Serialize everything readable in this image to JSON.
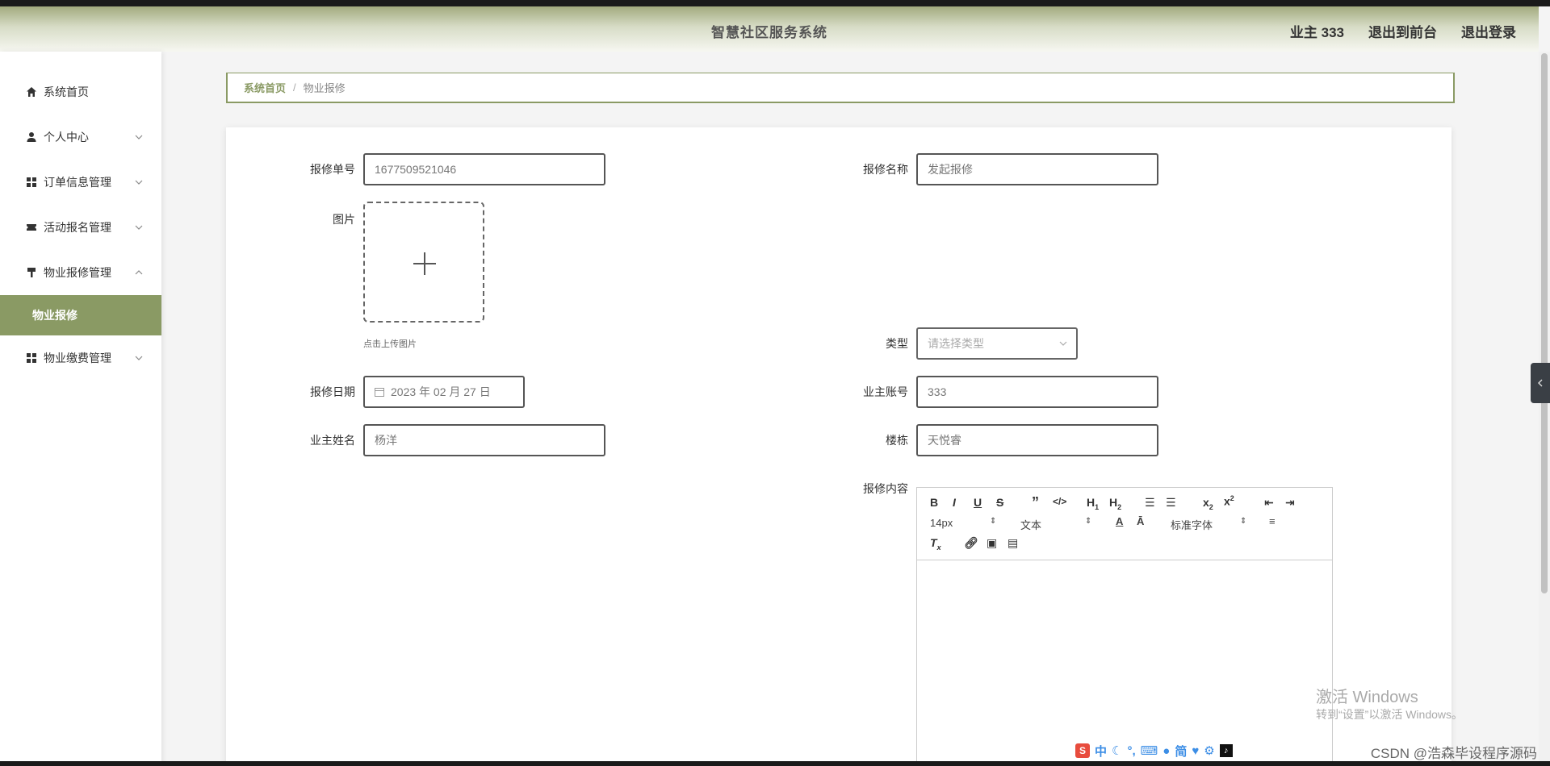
{
  "header": {
    "title": "智慧社区服务系统",
    "user": "业主 333",
    "to_front": "退出到前台",
    "logout": "退出登录"
  },
  "sidebar": {
    "items": [
      {
        "label": "系统首页",
        "icon": "home-icon"
      },
      {
        "label": "个人中心",
        "icon": "user-icon"
      },
      {
        "label": "订单信息管理",
        "icon": "grid-icon"
      },
      {
        "label": "活动报名管理",
        "icon": "ticket-icon"
      },
      {
        "label": "物业报修管理",
        "icon": "brush-icon"
      },
      {
        "label": "物业缴费管理",
        "icon": "grid-icon"
      }
    ],
    "active_sub": "物业报修"
  },
  "breadcrumb": {
    "home": "系统首页",
    "separator": "/",
    "current": "物业报修"
  },
  "form": {
    "repair_no_label": "报修单号",
    "repair_no_value": "1677509521046",
    "repair_name_label": "报修名称",
    "repair_name_value": "发起报修",
    "image_label": "图片",
    "upload_tip": "点击上传图片",
    "type_label": "类型",
    "type_placeholder": "请选择类型",
    "date_label": "报修日期",
    "date_value": "2023 年 02 月 27 日",
    "account_label": "业主账号",
    "account_value": "333",
    "owner_name_label": "业主姓名",
    "owner_name_value": "杨洋",
    "building_label": "楼栋",
    "building_value": "天悦睿",
    "content_label": "报修内容"
  },
  "editor": {
    "font_size": "14px",
    "block_type": "文本",
    "font_family": "标准字体"
  },
  "overlay": {
    "watermark_title": "激活 Windows",
    "watermark_sub": "转到“设置”以激活 Windows。",
    "ime_lang": "中",
    "ime_mode": "简",
    "csdn": "CSDN @浩森毕设程序源码"
  },
  "colors": {
    "accent": "#8a9a64"
  }
}
